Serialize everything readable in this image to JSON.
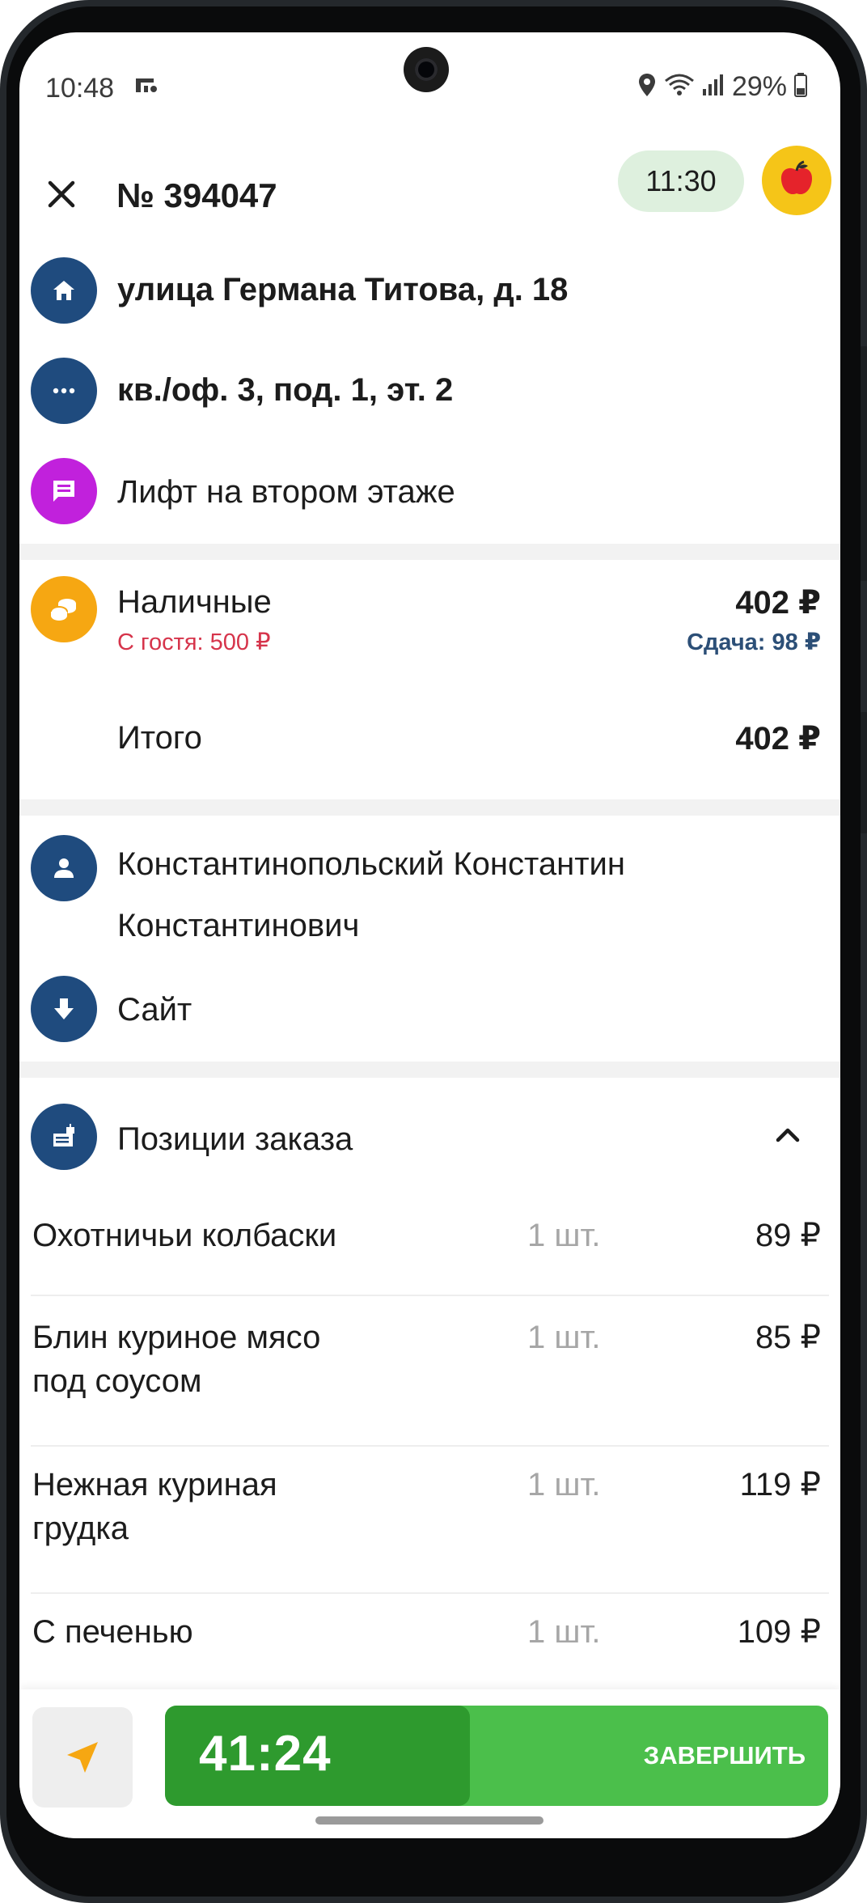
{
  "status_bar": {
    "time": "10:48",
    "battery": "29%"
  },
  "header": {
    "order_number": "№ 394047",
    "time_chip": "11:30"
  },
  "address": {
    "street": "улица Германа Титова, д. 18",
    "details": "кв./оф. 3, под. 1, эт. 2",
    "comment": "Лифт на втором этаже"
  },
  "payment": {
    "method": "Наличные",
    "amount": "402 ₽",
    "from_guest": "С гостя: 500 ₽",
    "change": "Сдача: 98 ₽",
    "total_label": "Итого",
    "total_amount": "402 ₽"
  },
  "customer": {
    "name_line1": "Константинопольский Константин",
    "name_line2": "Константинович",
    "source": "Сайт"
  },
  "order_items": {
    "section_title": "Позиции заказа",
    "items": [
      {
        "name": "Охотничьи колбаски",
        "qty": "1 шт.",
        "price": "89 ₽"
      },
      {
        "name": "Блин куриное мясо под соусом",
        "qty": "1 шт.",
        "price": "85 ₽"
      },
      {
        "name": "Нежная куриная грудка",
        "qty": "1 шт.",
        "price": "119 ₽"
      },
      {
        "name": "С печенью",
        "qty": "1 шт.",
        "price": "109 ₽"
      }
    ]
  },
  "bottom_bar": {
    "timer": "41:24",
    "finish_label": "ЗАВЕРШИТЬ",
    "timer_progress": 0.46
  },
  "icons": {
    "close": "close-icon",
    "home": "home-icon",
    "more": "more-icon",
    "comment": "comment-icon",
    "cash": "coins-icon",
    "person": "person-icon",
    "source": "download-icon",
    "items": "order-items-icon",
    "collapse": "chevron-up-icon",
    "navigation": "navigation-arrow-icon",
    "brand": "apple-logo-icon"
  },
  "colors": {
    "navy": "#1f4b7e",
    "purple": "#c121dc",
    "amber": "#f6a712",
    "green": "#4bbf4b",
    "green_dark": "#2e9a2e",
    "red_text": "#d6344b",
    "chip_bg": "#def0de"
  }
}
